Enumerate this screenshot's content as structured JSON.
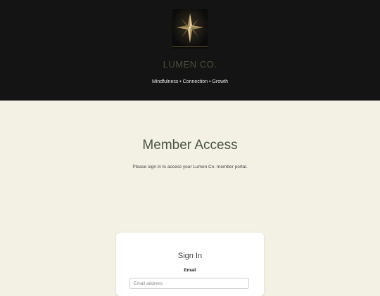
{
  "header": {
    "logo_icon": "compass-star-icon",
    "brand": "LUMEN CO.",
    "tagline": "Mindfulness • Connection • Growth"
  },
  "main": {
    "title": "Member Access",
    "subtitle": "Please sign in to access your Lumen Co. member portal."
  },
  "signin": {
    "title": "Sign In",
    "email_label": "Email",
    "email_placeholder": "Email address",
    "email_value": ""
  },
  "colors": {
    "header_bg": "#141414",
    "page_bg": "#f3f0e4",
    "accent": "#4b5541",
    "logo_gold": "#b9a06a"
  }
}
